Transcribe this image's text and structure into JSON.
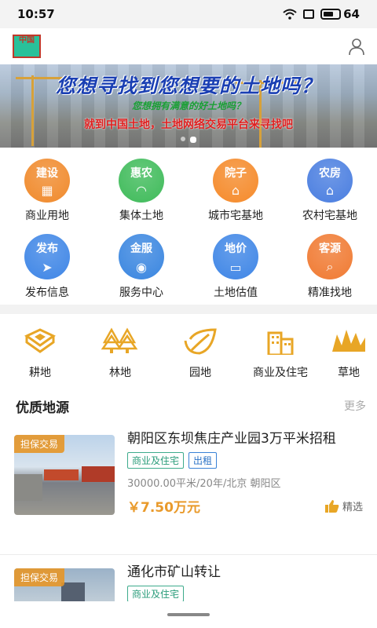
{
  "status_bar": {
    "time": "10:57",
    "battery": "64",
    "battery_fraction": 0.64
  },
  "header": {
    "logo_text": "中国"
  },
  "banner": {
    "title": "您想寻找到您想要的土地吗？",
    "subtitle": "您想拥有满意的好土地吗？",
    "subtitle2": "就到中国土地，土地网络交易平台来寻找吧",
    "slide_count": 2,
    "active_slide": 1
  },
  "services": [
    {
      "circle_text": "建设",
      "label": "商业用地",
      "icon": "building-icon",
      "color": "#f08a2c"
    },
    {
      "circle_text": "惠农",
      "label": "集体土地",
      "icon": "field-icon",
      "color": "#3fbb5a"
    },
    {
      "circle_text": "院子",
      "label": "城市宅基地",
      "icon": "house-roof-icon",
      "color": "#f58a2a"
    },
    {
      "circle_text": "农房",
      "label": "农村宅基地",
      "icon": "farmhouse-icon",
      "color": "#4a7ee0"
    },
    {
      "circle_text": "发布",
      "label": "发布信息",
      "icon": "send-icon",
      "color": "#3f86e6"
    },
    {
      "circle_text": "金服",
      "label": "服务中心",
      "icon": "coins-icon",
      "color": "#3a86e0"
    },
    {
      "circle_text": "地价",
      "label": "土地估值",
      "icon": "land-value-icon",
      "color": "#3f86e6"
    },
    {
      "circle_text": "客源",
      "label": "精准找地",
      "icon": "search-land-icon",
      "color": "#f07a32"
    }
  ],
  "categories": [
    {
      "label": "耕地",
      "icon": "farmland-icon"
    },
    {
      "label": "林地",
      "icon": "forest-icon"
    },
    {
      "label": "园地",
      "icon": "leaf-icon"
    },
    {
      "label": "商业及住宅",
      "icon": "buildings-icon"
    },
    {
      "label": "草地",
      "icon": "grass-icon"
    }
  ],
  "section": {
    "title": "优质地源",
    "more": "更多"
  },
  "listings": [
    {
      "tag": "担保交易",
      "title": "朝阳区东坝焦庄产业园3万平米招租",
      "chips": [
        "商业及住宅",
        "出租"
      ],
      "meta": "30000.00平米/20年/北京 朝阳区",
      "price": "￥7.50万元",
      "badge": "精选"
    },
    {
      "tag": "担保交易",
      "title": "通化市矿山转让",
      "chips": [
        "商业及住宅"
      ],
      "meta": "",
      "price": "",
      "badge": ""
    }
  ],
  "colors": {
    "accent": "#e99a2b",
    "chip_green": "#2a9c7a",
    "chip_blue": "#2a72c6",
    "icon_gold": "#e8a626"
  }
}
